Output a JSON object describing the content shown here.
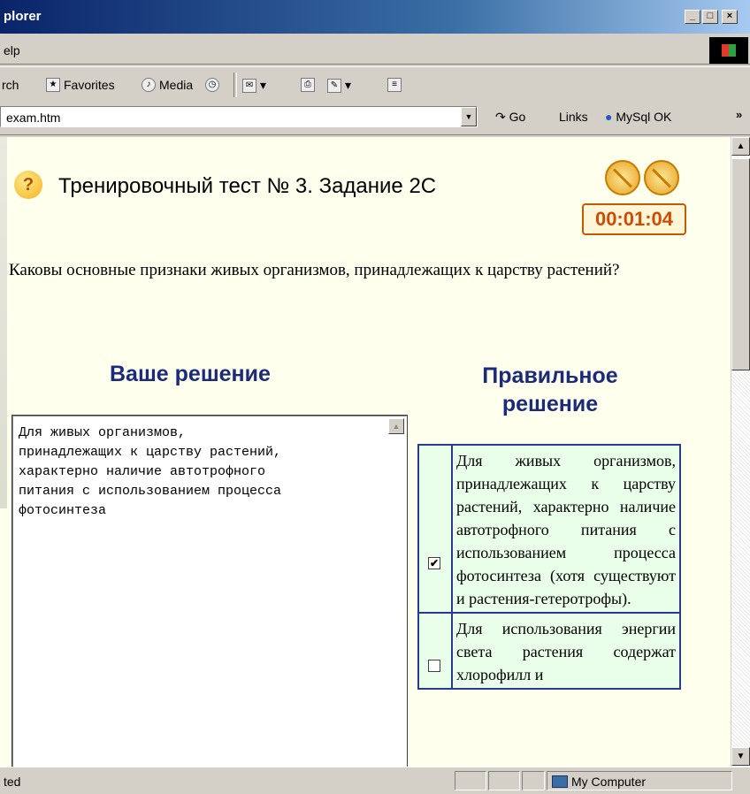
{
  "window": {
    "title": "plorer",
    "buttons": {
      "minimize": "_",
      "maximize": "□",
      "close": "×"
    }
  },
  "menubar": {
    "item": "elp"
  },
  "toolbar": {
    "search": "rch",
    "favorites": "Favorites",
    "media": "Media"
  },
  "address": {
    "url": "exam.htm",
    "go": "Go",
    "links": "Links",
    "favlink": "MySql OK",
    "more": "»"
  },
  "page": {
    "title": "Тренировочный тест № 3. Задание 2С",
    "timer": "00:01:04",
    "question": "Каковы основные признаки живых организмов, принадлежащих к царству растений?",
    "your_solution_title": "Ваше решение",
    "correct_solution_title": "Правильное решение",
    "your_answer": "Для живых организмов,\nпринадлежащих к царству растений,\nхарактерно наличие автотрофного\nпитания с использованием процесса\nфотосинтеза",
    "correct_answers": [
      {
        "checked": true,
        "text": "Для живых организмов, принадлежащих к царству растений, характерно наличие автотрофного питания с использованием процесса фотосинтеза (хотя существуют и растения-гетеротрофы)."
      },
      {
        "checked": false,
        "text": "Для использования энергии света растения содержат хлорофилл и"
      }
    ]
  },
  "statusbar": {
    "text": "ted",
    "zone": "My Computer"
  }
}
